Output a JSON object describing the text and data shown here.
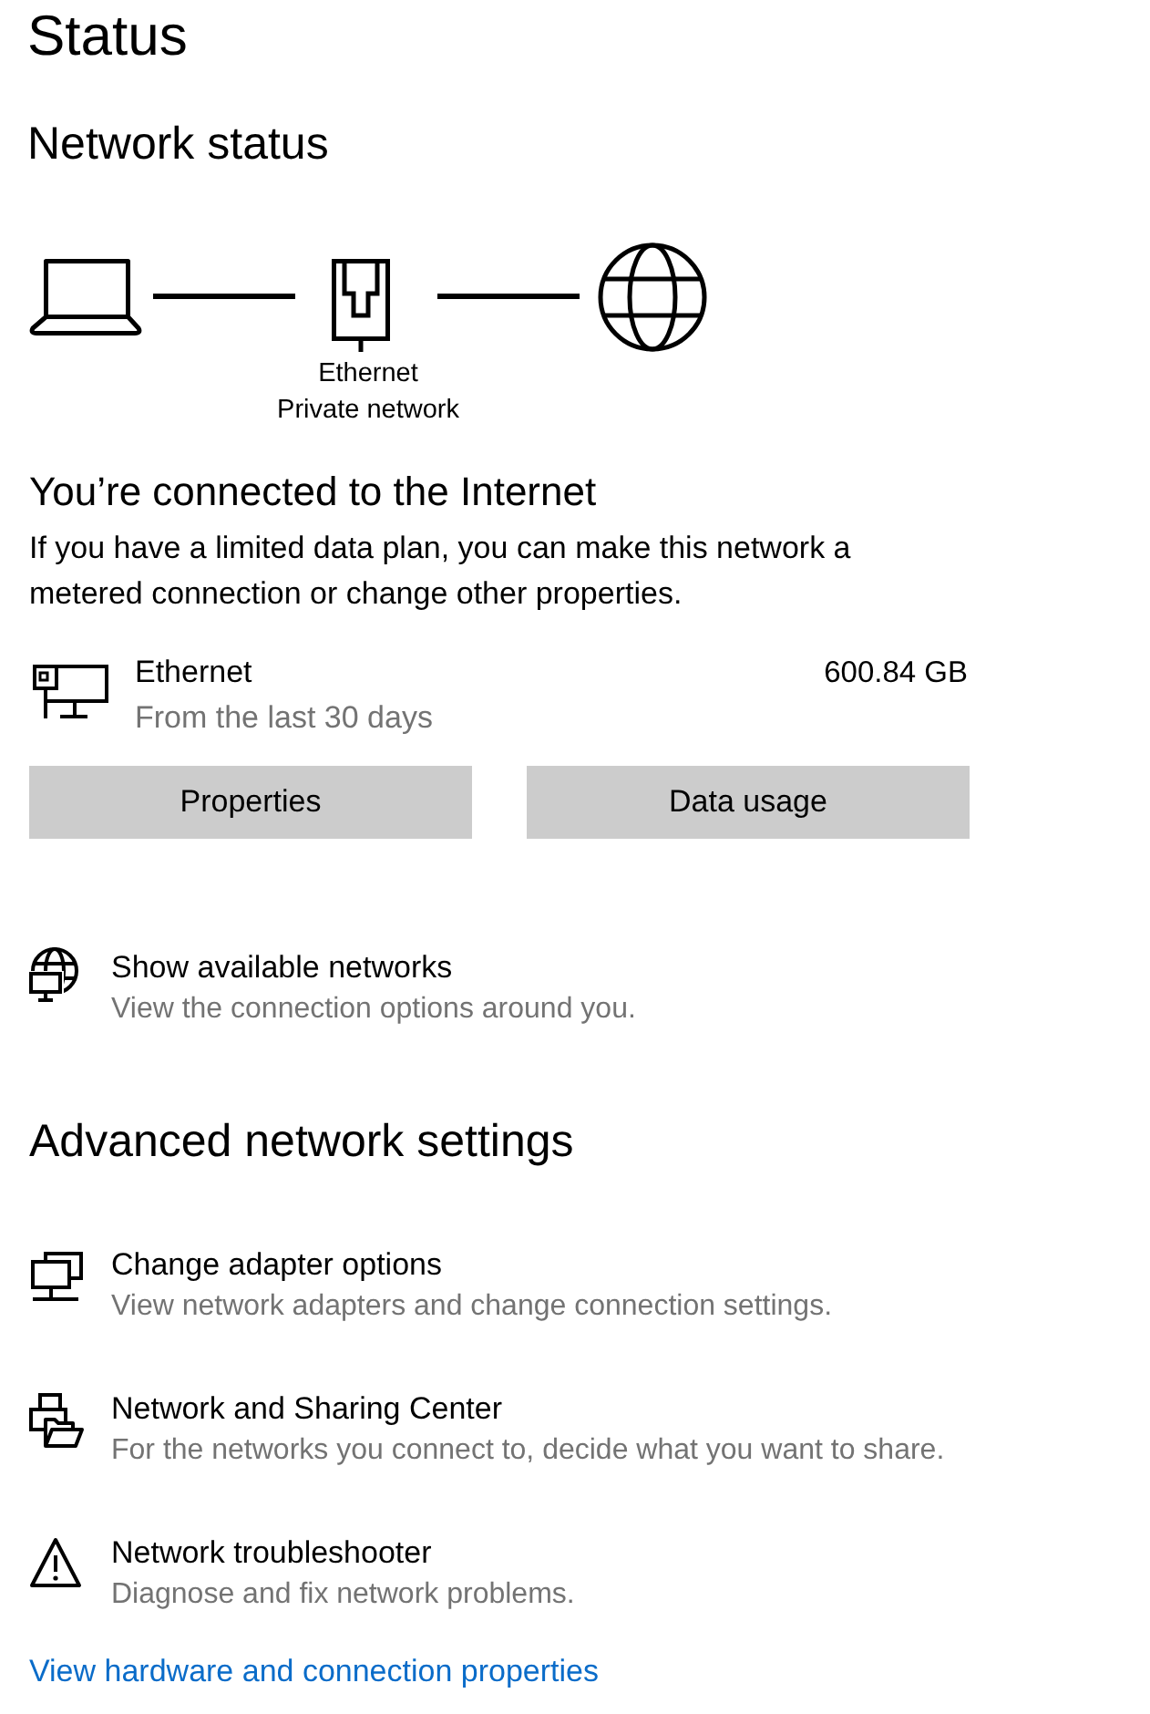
{
  "page": {
    "title": "Status"
  },
  "network_status": {
    "heading": "Network status",
    "adapter_label": "Ethernet",
    "network_label": "Private network"
  },
  "connection": {
    "heading": "You’re connected to the Internet",
    "description": "If you have a limited data plan, you can make this network a metered connection or change other properties."
  },
  "adapter": {
    "name": "Ethernet",
    "period": "From the last 30 days",
    "usage": "600.84 GB"
  },
  "buttons": [
    {
      "label": "Properties"
    },
    {
      "label": "Data usage"
    }
  ],
  "show_networks": {
    "kind": "globe-monitor",
    "title": "Show available networks",
    "description": "View the connection options around you."
  },
  "advanced": {
    "heading": "Advanced network settings",
    "items": [
      {
        "kind": "adapter",
        "title": "Change adapter options",
        "description": "View network adapters and change connection settings."
      },
      {
        "kind": "sharing",
        "title": "Network and Sharing Center",
        "description": "For the networks you connect to, decide what you want to share."
      },
      {
        "kind": "warning",
        "title": "Network troubleshooter",
        "description": "Diagnose and fix network problems."
      }
    ]
  },
  "link": {
    "label": "View hardware and connection properties"
  }
}
